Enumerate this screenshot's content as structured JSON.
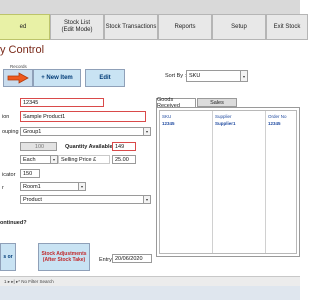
{
  "tabs": [
    {
      "label": "ed",
      "active": true
    },
    {
      "label": "Stock List\n(Edit Mode)",
      "active": false
    },
    {
      "label": "Stock Transactions",
      "active": false
    },
    {
      "label": "Reports",
      "active": false
    },
    {
      "label": "Setup",
      "active": false
    },
    {
      "label": "Exit Stock",
      "active": false
    }
  ],
  "page_title": "y Control",
  "records_label": "Records",
  "toolbar": {
    "new_item_label": "+ New Item",
    "edit_label": "Edit",
    "sort_label": "Sort By :",
    "sort_value": "SKU"
  },
  "form": {
    "sku_value": "12345",
    "description_label": "ion",
    "description_value": "Sample Product1",
    "grouping_label": "ouping",
    "grouping_value": "Group1",
    "quantity_input": "100",
    "quantity_available_label": "Quantity Available",
    "quantity_available_value": "149",
    "unit_value": "Each",
    "selling_price_label": "Selling Price £",
    "selling_price_value": "25.00",
    "indicator_label": "icator",
    "indicator_value": "150",
    "location_label": "r",
    "location_value": "Room1",
    "type_value": "Product",
    "discontinued_label": "ontinued?",
    "entry_date_label": "Entry Date",
    "entry_date_value": "20/06/2020"
  },
  "subtabs": {
    "goods_received": "Goods Received",
    "sales": "Sales"
  },
  "goods_table": {
    "headers": [
      "SKU",
      "Supplier",
      "Order No"
    ],
    "rows": [
      [
        "12345",
        "Supplier1",
        "12345"
      ]
    ]
  },
  "buttons": {
    "stock_adjustments": "Stock Adjustments\n(After Stock Take)",
    "left_label": "s or"
  },
  "status_text": "1 ▸  ▸|  ▸*   No Filter   Search"
}
